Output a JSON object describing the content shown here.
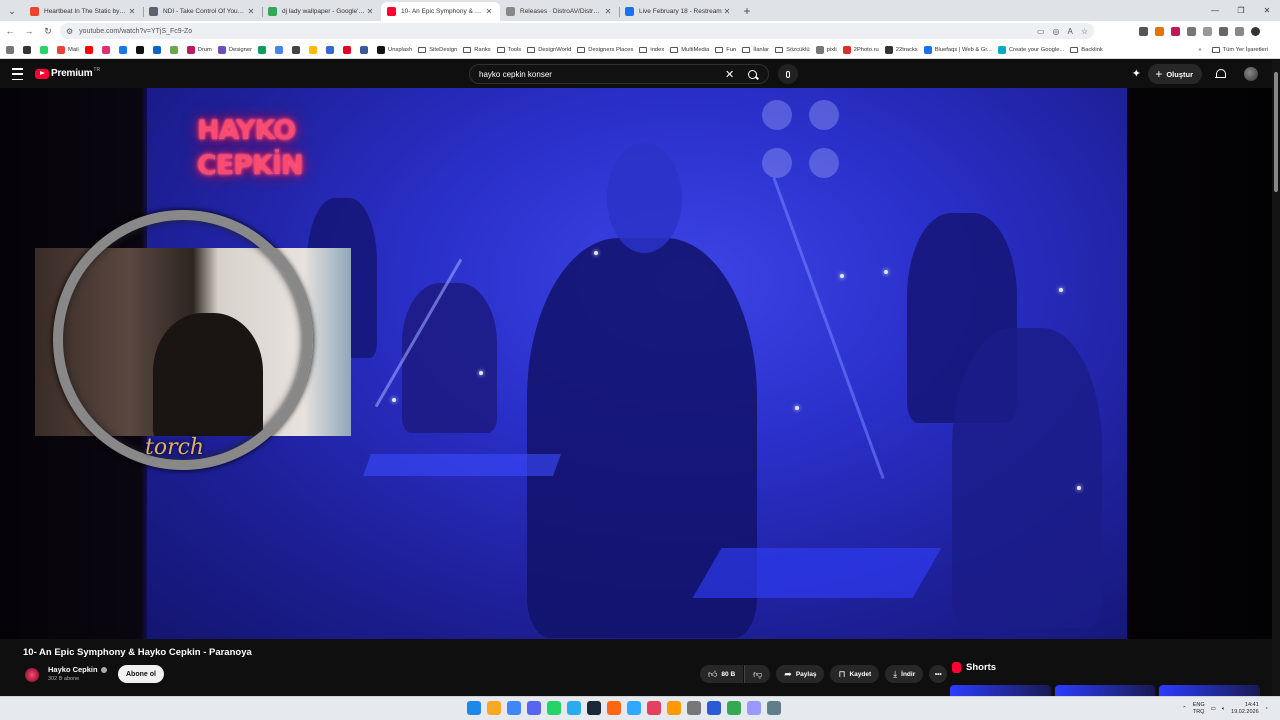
{
  "browser": {
    "tabs": [
      {
        "title": "Heartbeat In The Static by Bubb",
        "color": "#e8452c",
        "active": false
      },
      {
        "title": "NDI - Take Control Of Your Cor",
        "color": "#5b6270",
        "active": false
      },
      {
        "title": "dj lady wallpaper - Google'da A",
        "color": "#34a853",
        "active": false
      },
      {
        "title": "10- An Epic Symphony & Hayko",
        "color": "#ff0033",
        "active": true
      },
      {
        "title": "Releases · DistroAV/DistroAV",
        "color": "#888888",
        "active": false
      },
      {
        "title": "Live February 18 - Restream",
        "color": "#1a73e8",
        "active": false
      }
    ],
    "url": "youtube.com/watch?v=YTjS_Fc9-Zo",
    "bookmarks": [
      {
        "label": "",
        "color": "#333333",
        "folder": false
      },
      {
        "label": "",
        "color": "#25d366",
        "folder": false
      },
      {
        "label": "Mail",
        "color": "#ea4335",
        "folder": false
      },
      {
        "label": "",
        "color": "#ff0000",
        "folder": false
      },
      {
        "label": "",
        "color": "#e1306c",
        "folder": false
      },
      {
        "label": "",
        "color": "#1877f2",
        "folder": false
      },
      {
        "label": "",
        "color": "#111111",
        "folder": false
      },
      {
        "label": "",
        "color": "#0a66c2",
        "folder": false
      },
      {
        "label": "",
        "color": "#6aa84f",
        "folder": false
      },
      {
        "label": "Drum",
        "color": "#c2185b",
        "folder": false
      },
      {
        "label": "Designer",
        "color": "#6b4fbb",
        "folder": false
      },
      {
        "label": "",
        "color": "#0f9d58",
        "folder": false
      },
      {
        "label": "",
        "color": "#4285f4",
        "folder": false
      },
      {
        "label": "",
        "color": "#444444",
        "folder": false
      },
      {
        "label": "",
        "color": "#fbbc05",
        "folder": false
      },
      {
        "label": "",
        "color": "#3367d6",
        "folder": false
      },
      {
        "label": "",
        "color": "#e60023",
        "folder": false
      },
      {
        "label": "",
        "color": "#3b5998",
        "folder": false
      },
      {
        "label": "Unsplash",
        "color": "#111111",
        "folder": false
      },
      {
        "label": "SiteDesign",
        "color": "",
        "folder": true
      },
      {
        "label": "Ranks",
        "color": "",
        "folder": true
      },
      {
        "label": "Tools",
        "color": "",
        "folder": true
      },
      {
        "label": "DesignWorld",
        "color": "",
        "folder": true
      },
      {
        "label": "Designers Places",
        "color": "",
        "folder": true
      },
      {
        "label": "index",
        "color": "",
        "folder": true
      },
      {
        "label": "MultiMedia",
        "color": "",
        "folder": true
      },
      {
        "label": "Fun",
        "color": "",
        "folder": true
      },
      {
        "label": "İlanlar",
        "color": "",
        "folder": true
      },
      {
        "label": "Sözcüklü",
        "color": "",
        "folder": true
      },
      {
        "label": "pixli",
        "color": "#777777",
        "folder": false
      },
      {
        "label": "2Photo.ru",
        "color": "#d93025",
        "folder": false
      },
      {
        "label": "22tracks",
        "color": "#333333",
        "folder": false
      },
      {
        "label": "Bluefaqs | Web & Gr...",
        "color": "#1a73e8",
        "folder": false
      },
      {
        "label": "Create your Google...",
        "color": "#00acc1",
        "folder": false
      },
      {
        "label": "Backlink",
        "color": "",
        "folder": true
      }
    ],
    "bookmarks_more": "»",
    "all_bookmarks": "Tüm Yer İşaretleri"
  },
  "youtube": {
    "logo_text": "Premium",
    "logo_superscript": "TR",
    "search_query": "hayko cepkin konser",
    "create_label": "Oluştur",
    "video": {
      "neon_line1": "HAYKO",
      "neon_line2": "CEPKİN",
      "overlay_text": "torch",
      "title": "10- An Epic Symphony & Hayko Cepkin - Paranoya",
      "channel": "Hayko Cepkin",
      "subscribers": "302 B abone",
      "subscribe_label": "Abone ol",
      "likes": "80 B",
      "share_label": "Paylaş",
      "save_label": "Kaydet",
      "download_label": "İndir"
    },
    "shorts_label": "Shorts"
  },
  "taskbar": {
    "app_colors": [
      "#1e88e5",
      "#f9a825",
      "#4285f4",
      "#5865f2",
      "#25d366",
      "#2aabee",
      "#1b2838",
      "#ff6611",
      "#31a8ff",
      "#e4405f",
      "#ff9a00",
      "#777777",
      "#2a5bd7",
      "#34a853",
      "#9999ff",
      "#607d8b"
    ],
    "lang_line1": "ENG",
    "lang_line2": "TRQ",
    "time": "14:41",
    "date": "19.02.2026"
  }
}
